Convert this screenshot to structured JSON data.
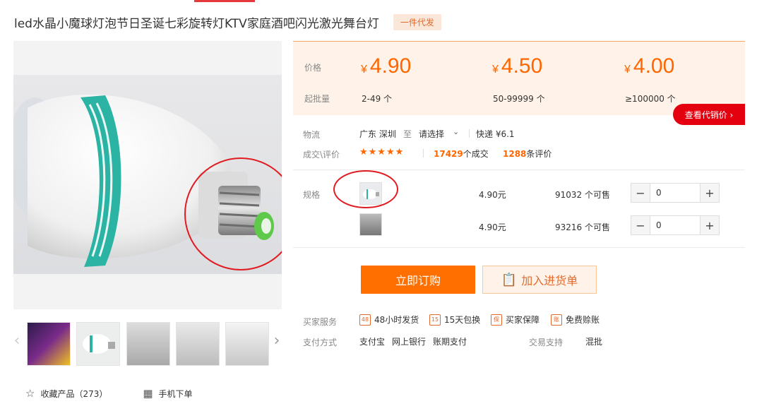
{
  "product": {
    "title": "led水晶小魔球灯泡节日圣诞七彩旋转灯KTV家庭酒吧闪光激光舞台灯",
    "badge": "一件代发"
  },
  "price_box": {
    "price_label": "价格",
    "min_qty_label": "起批量",
    "currency": "¥",
    "tiers": [
      {
        "price": "4.90",
        "range": "2-49 个"
      },
      {
        "price": "4.50",
        "range": "50-99999 个"
      },
      {
        "price": "4.00",
        "range": "≥100000 个"
      }
    ],
    "agent_button": "查看代销价 ›"
  },
  "logistics": {
    "label": "物流",
    "from": "广东 深圳",
    "to_word": "至",
    "to_select": "请选择",
    "shipping": "快递 ¥6.1"
  },
  "deals": {
    "label": "成交\\评价",
    "stars": "★★★★★",
    "deal_count": "17429",
    "deal_suffix": "个成交",
    "review_count": "1288",
    "review_suffix": "条评价"
  },
  "specs": {
    "label": "规格",
    "rows": [
      {
        "price": "4.90元",
        "stock": "91032 个可售",
        "qty": "0"
      },
      {
        "price": "4.90元",
        "stock": "93216 个可售",
        "qty": "0"
      }
    ]
  },
  "buttons": {
    "buy": "立即订购",
    "cart": "加入进货单"
  },
  "services": {
    "label": "买家服务",
    "items": [
      {
        "icon": "48",
        "text": "48小时发货"
      },
      {
        "icon": "15",
        "text": "15天包换"
      },
      {
        "icon": "保",
        "text": "买家保障"
      },
      {
        "icon": "账",
        "text": "免费赊账"
      }
    ]
  },
  "payment": {
    "label": "支付方式",
    "methods": [
      "支付宝",
      "网上银行",
      "账期支付"
    ],
    "trade_label": "交易支持",
    "trade_value": "混批"
  },
  "bottom_actions": {
    "favorite": "收藏产品（273）",
    "mobile": "手机下单"
  },
  "colors": {
    "accent": "#ff6600",
    "buy": "#ff6f00",
    "price_bg": "#fff3e9",
    "agent_red": "#e4000f",
    "annotation_red": "#e11b22"
  }
}
